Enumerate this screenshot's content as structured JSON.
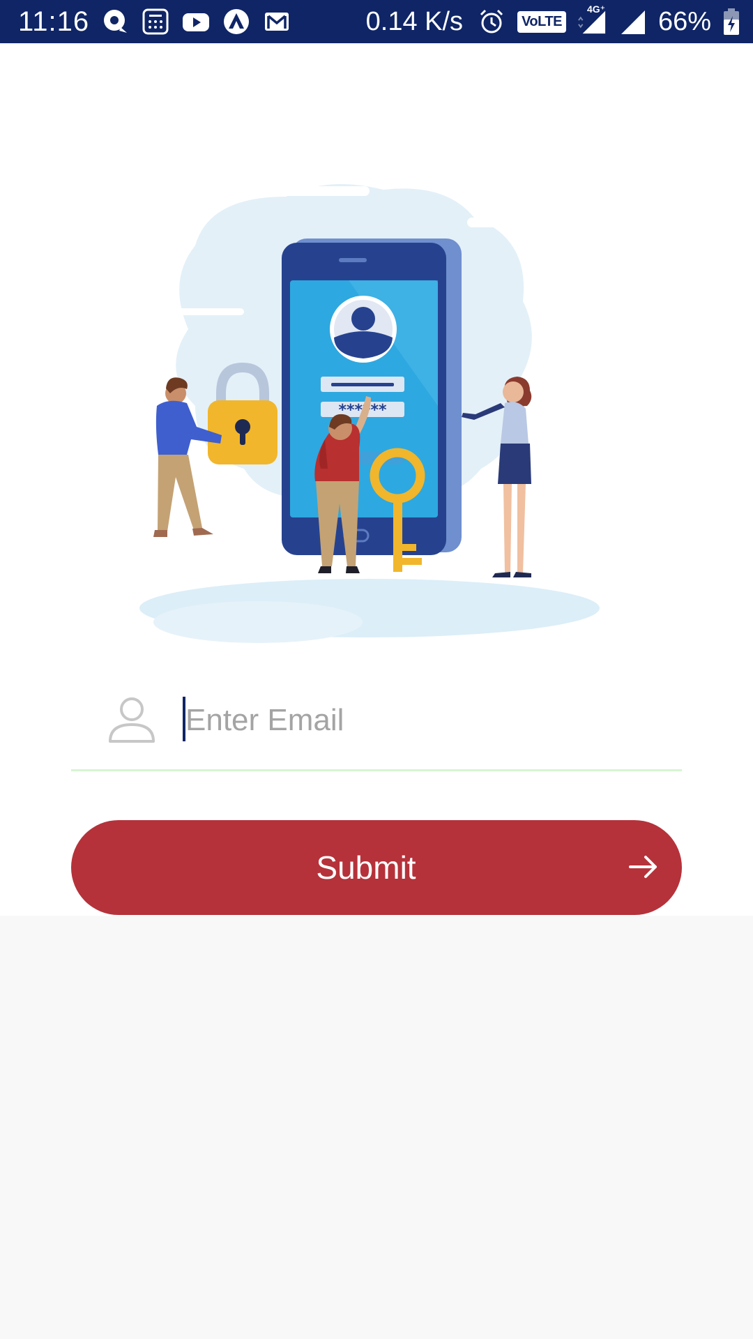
{
  "status_bar": {
    "time": "11:16",
    "network_speed": "0.14 K/s",
    "network_type": "4G⁺",
    "volte": "VoLTE",
    "battery": "66%",
    "notification_icons": [
      "chat-icon",
      "calculator-icon",
      "youtube-icon",
      "triangle-app-icon",
      "gmail-icon"
    ],
    "bg_color": "#0f2566"
  },
  "illustration": {
    "password_mask": "******",
    "icon": "phone-login-security-illustration"
  },
  "email": {
    "placeholder": "Enter Email",
    "value": "",
    "icon": "person-icon"
  },
  "submit": {
    "label": "Submit",
    "icon": "arrow-right-icon",
    "color": "#b5323a"
  }
}
